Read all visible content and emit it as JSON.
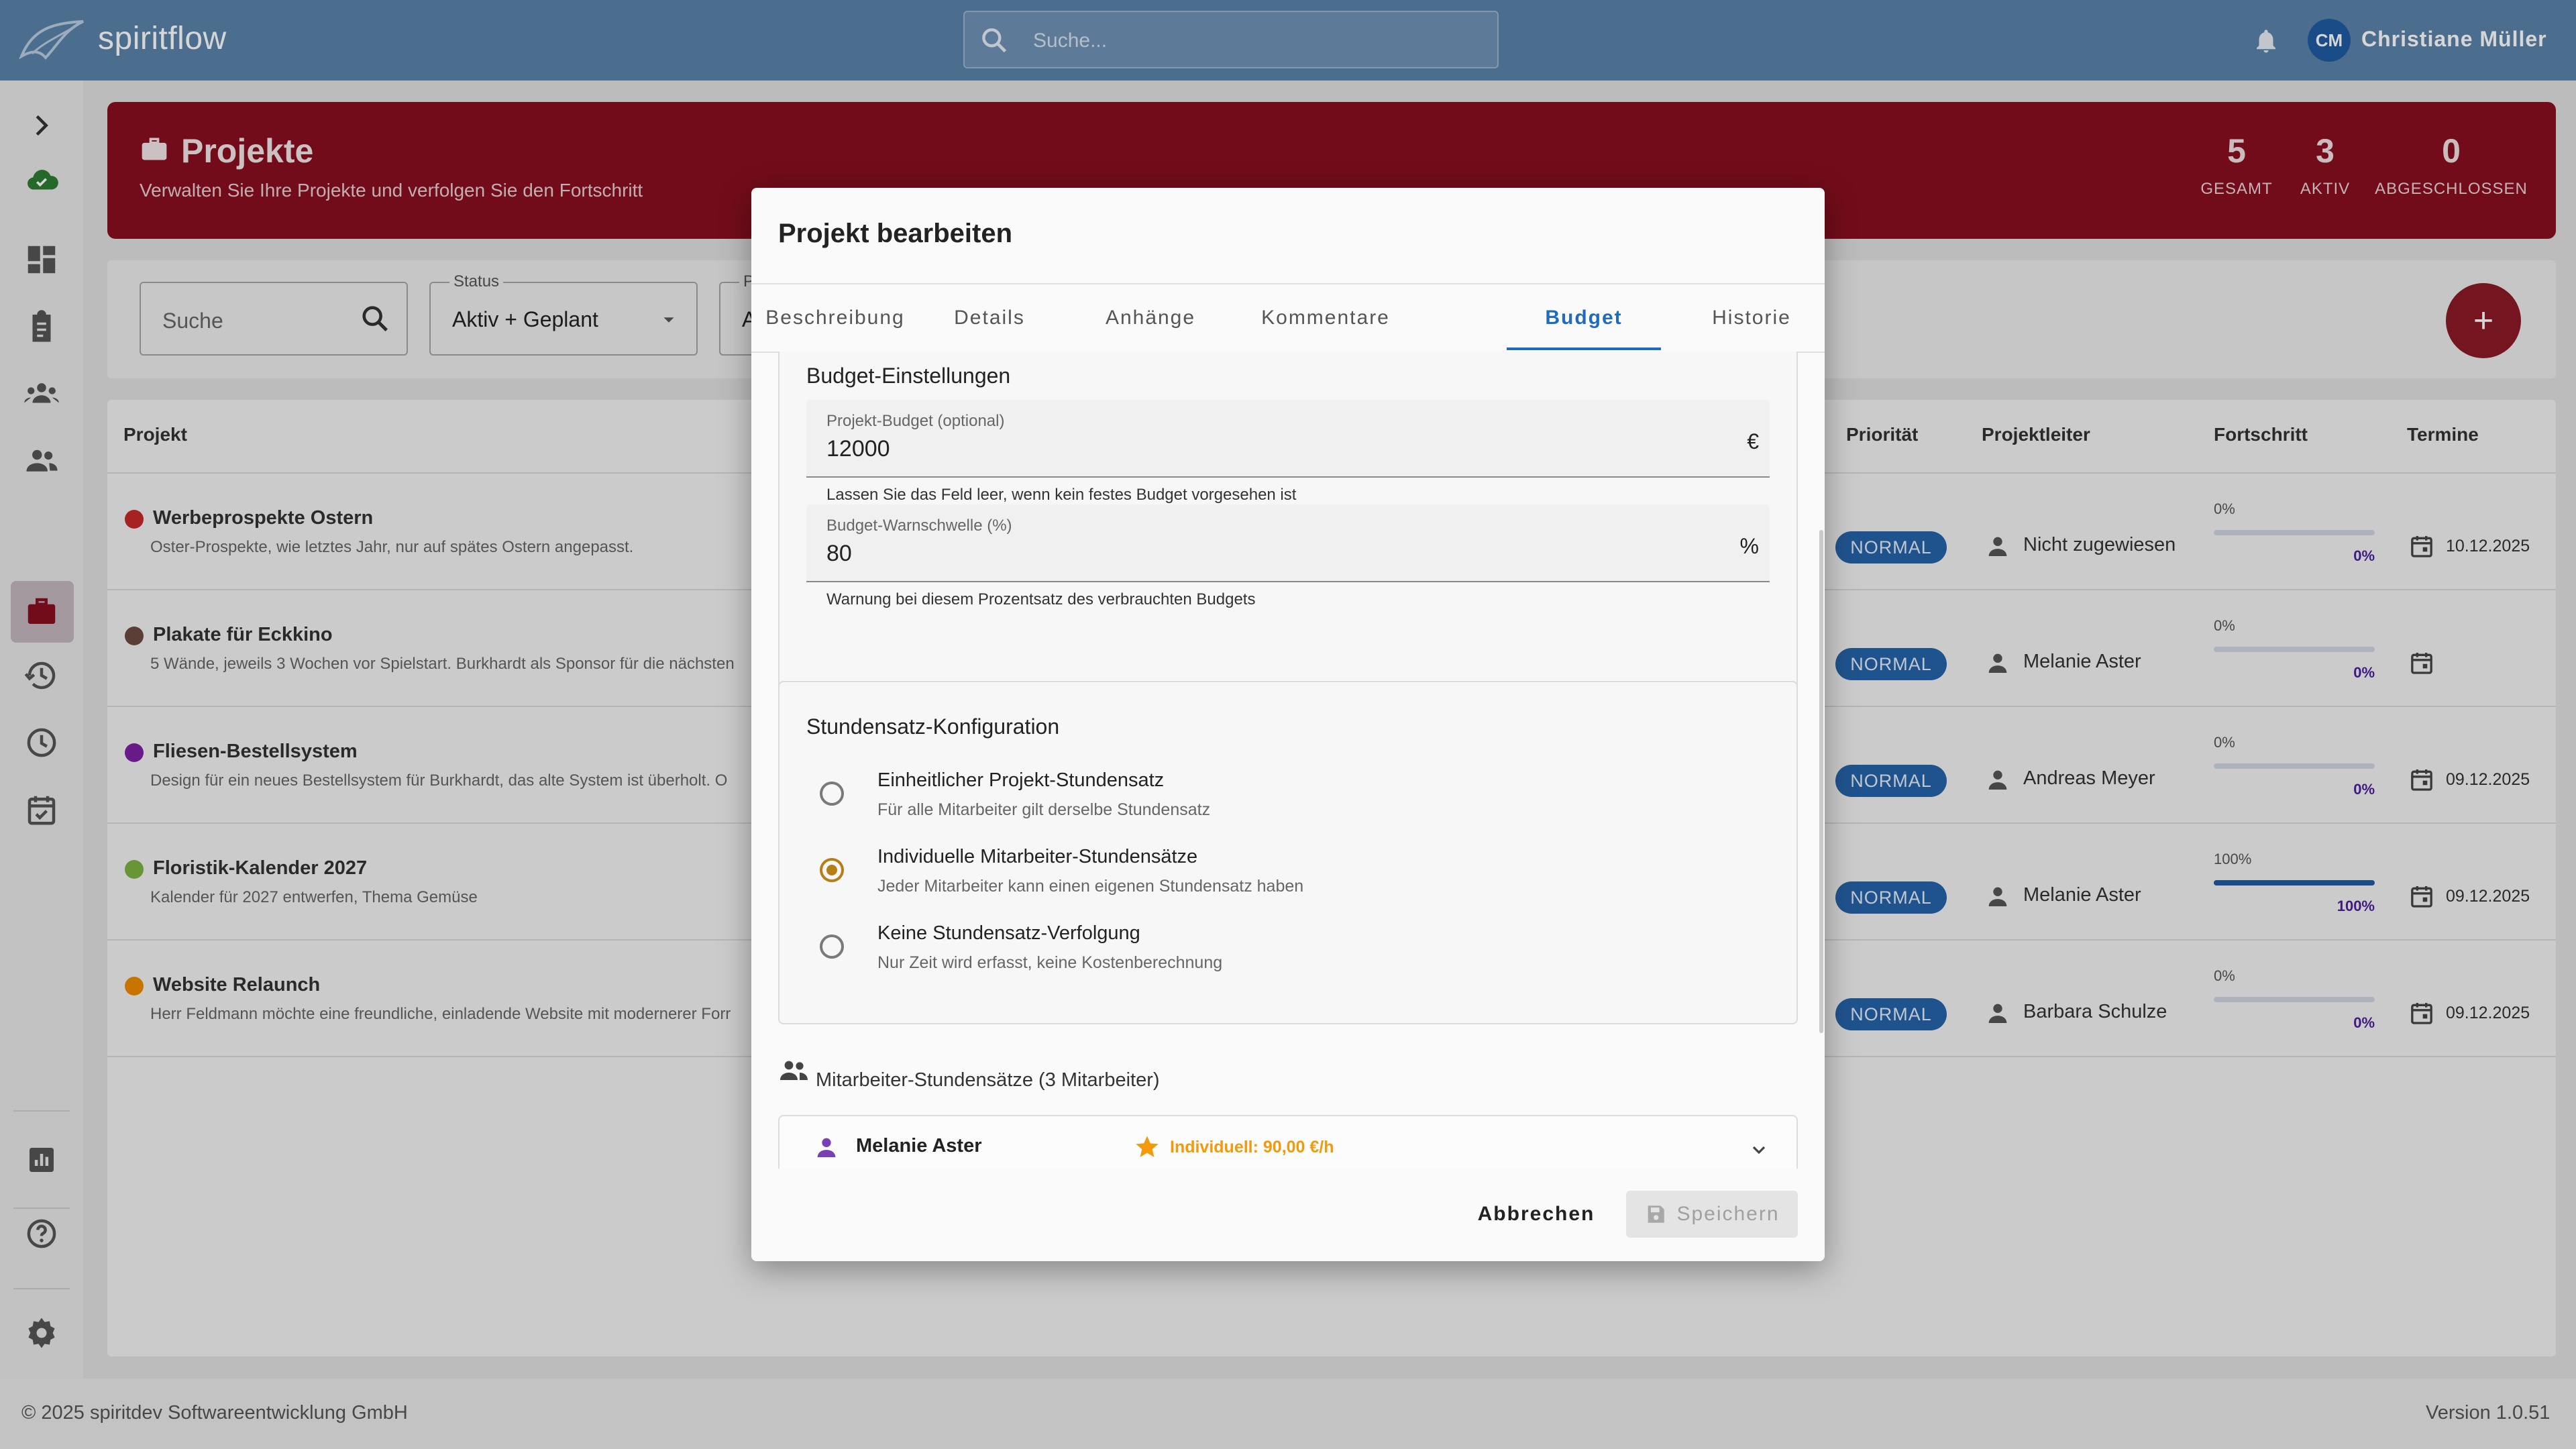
{
  "app": {
    "brand": "spiritflow",
    "search_placeholder": "Suche...",
    "user": {
      "initials": "CM",
      "name": "Christiane Müller"
    }
  },
  "banner": {
    "title": "Projekte",
    "subtitle": "Verwalten Sie Ihre Projekte und verfolgen Sie den Fortschritt",
    "stats": [
      {
        "value": "5",
        "label": "GESAMT"
      },
      {
        "value": "3",
        "label": "AKTIV"
      },
      {
        "value": "0",
        "label": "ABGESCHLOSSEN"
      }
    ]
  },
  "filters": {
    "search_label": "Suche",
    "status_label": "Status",
    "status_value": "Aktiv + Geplant",
    "third_label": "P",
    "third_value": "A"
  },
  "table": {
    "headers": {
      "project": "Projekt",
      "priority": "Priorität",
      "lead": "Projektleiter",
      "progress": "Fortschritt",
      "dates": "Termine"
    },
    "rows": [
      {
        "title": "Werbeprospekte Ostern",
        "desc": "Oster-Prospekte, wie letztes Jahr, nur auf spätes Ostern angepasst.",
        "color": "#c62828",
        "priority": "NORMAL",
        "lead": "Nicht zugewiesen",
        "progress_label": "0%",
        "progress_value": "0%",
        "progress": 0,
        "date": "10.12.2025"
      },
      {
        "title": "Plakate für Eckkino",
        "desc": "5 Wände, jeweils 3 Wochen vor Spielstart. Burkhardt als Sponsor für die nächsten",
        "color": "#6d4c41",
        "priority": "NORMAL",
        "lead": "Melanie Aster",
        "progress_label": "0%",
        "progress_value": "0%",
        "progress": 0,
        "date": ""
      },
      {
        "title": "Fliesen-Bestellsystem",
        "desc": "Design für ein neues Bestellsystem für Burkhardt, das alte System ist überholt. O",
        "color": "#7b1fa2",
        "priority": "NORMAL",
        "lead": "Andreas Meyer",
        "progress_label": "0%",
        "progress_value": "0%",
        "progress": 0,
        "date": "09.12.2025"
      },
      {
        "title": "Floristik-Kalender 2027",
        "desc": "Kalender für 2027 entwerfen, Thema Gemüse",
        "color": "#7cb342",
        "priority": "NORMAL",
        "lead": "Melanie Aster",
        "progress_label": "100%",
        "progress_value": "100%",
        "progress": 100,
        "date": "09.12.2025"
      },
      {
        "title": "Website Relaunch",
        "desc": "Herr Feldmann möchte eine freundliche, einladende Website mit modernerer Forr",
        "color": "#ef8c00",
        "priority": "NORMAL",
        "lead": "Barbara Schulze",
        "progress_label": "0%",
        "progress_value": "0%",
        "progress": 0,
        "date": "09.12.2025"
      }
    ]
  },
  "footer": {
    "copyright": "© 2025 spiritdev Softwareentwicklung GmbH",
    "version": "Version 1.0.51"
  },
  "dialog": {
    "title": "Projekt bearbeiten",
    "tabs": [
      "Beschreibung",
      "Details",
      "Anhänge",
      "Kommentare",
      "Budget",
      "Historie"
    ],
    "active_tab": "Budget",
    "budget": {
      "heading": "Budget-Einstellungen",
      "budget_label": "Projekt-Budget (optional)",
      "budget_value": "12000",
      "budget_suffix": "€",
      "budget_help": "Lassen Sie das Feld leer, wenn kein festes Budget vorgesehen ist",
      "warn_label": "Budget-Warnschwelle (%)",
      "warn_value": "80",
      "warn_suffix": "%",
      "warn_help": "Warnung bei diesem Prozentsatz des verbrauchten Budgets"
    },
    "rates": {
      "heading": "Stundensatz-Konfiguration",
      "options": [
        {
          "label": "Einheitlicher Projekt-Stundensatz",
          "desc": "Für alle Mitarbeiter gilt derselbe Stundensatz",
          "selected": false
        },
        {
          "label": "Individuelle Mitarbeiter-Stundensätze",
          "desc": "Jeder Mitarbeiter kann einen eigenen Stundensatz haben",
          "selected": true
        },
        {
          "label": "Keine Stundensatz-Verfolgung",
          "desc": "Nur Zeit wird erfasst, keine Kostenberechnung",
          "selected": false
        }
      ]
    },
    "employees": {
      "heading": "Mitarbeiter-Stundensätze (3 Mitarbeiter)",
      "first_name": "Melanie Aster",
      "first_rate": "Individuell: 90,00 €/h"
    },
    "cancel_label": "Abbrechen",
    "save_label": "Speichern"
  },
  "colors": {
    "topbar": "#5b84aa",
    "banner": "#8a0f1f",
    "primary": "#1f6bbf",
    "accent": "#b77e16",
    "chip": "#2563a8"
  }
}
